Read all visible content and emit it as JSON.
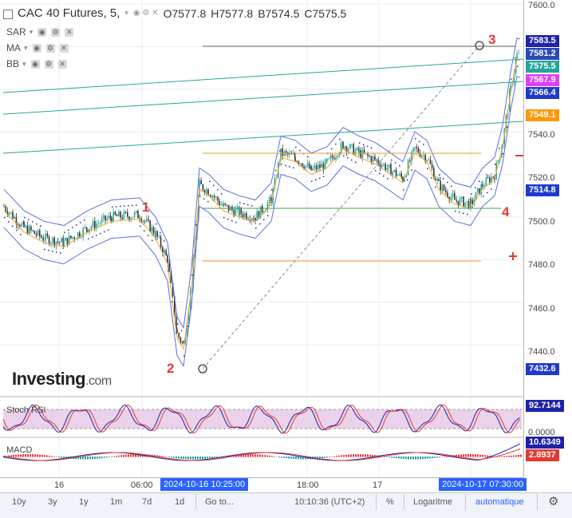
{
  "header": {
    "symbol": "CAC 40 Futures, 5,",
    "open": "O7577.8",
    "high": "H7577.8",
    "low": "B7574.5",
    "close": "C7575.5",
    "indicators": [
      "SAR",
      "MA",
      "BB"
    ]
  },
  "price_axis": {
    "ticks": [
      "7600.0",
      "7540.0",
      "7520.0",
      "7500.0",
      "7480.0",
      "7460.0",
      "7440.0"
    ],
    "tags": [
      {
        "text": "7583.5",
        "color": "#1e22aa"
      },
      {
        "text": "7581.2",
        "color": "#2a48b8"
      },
      {
        "text": "7575.5",
        "color": "#26a69a"
      },
      {
        "text": "7567.9",
        "color": "#e040fb"
      },
      {
        "text": "7566.4",
        "color": "#1e3bcc"
      },
      {
        "text": "7549.1",
        "color": "#ff9800"
      },
      {
        "text": "7514.8",
        "color": "#1e3bcc"
      },
      {
        "text": "7432.6",
        "color": "#1e3bcc"
      }
    ]
  },
  "wave_labels": [
    "1",
    "2",
    "3",
    "4"
  ],
  "logo": {
    "main": "Investing",
    "suffix": ".com"
  },
  "stoch_rsi": {
    "label": "Stoch RSI",
    "value": "92.7144",
    "color": "#1e22aa"
  },
  "macd": {
    "label": "MACD",
    "zero": "0.0000",
    "values": [
      {
        "text": "10.6349",
        "color": "#1e22aa"
      },
      {
        "text": "2.8937",
        "color": "#e53935"
      }
    ]
  },
  "time_axis": {
    "labels": [
      "16",
      "06:00",
      "18:00",
      "17"
    ],
    "highlight_start": "2024-10-16 10:25:00",
    "highlight_end": "2024-10-17 07:30:00"
  },
  "bottom_bar": {
    "ranges": [
      "10y",
      "3y",
      "1y",
      "1m",
      "7d",
      "1d"
    ],
    "goto": "Go to...",
    "clock": "10:10:36 (UTC+2)",
    "percent": "%",
    "log": "Logaritme",
    "auto": "automatique",
    "auto_color": "#2962ff"
  },
  "chart_data": {
    "type": "candlestick",
    "title": "CAC 40 Futures, 5,",
    "ylim": [
      7425,
      7600
    ],
    "overlays": [
      "SAR",
      "MA",
      "BB"
    ],
    "annotations": [
      "1",
      "2",
      "3",
      "4"
    ],
    "last": {
      "open": 7577.8,
      "high": 7577.8,
      "low": 7574.5,
      "close": 7575.5
    }
  }
}
